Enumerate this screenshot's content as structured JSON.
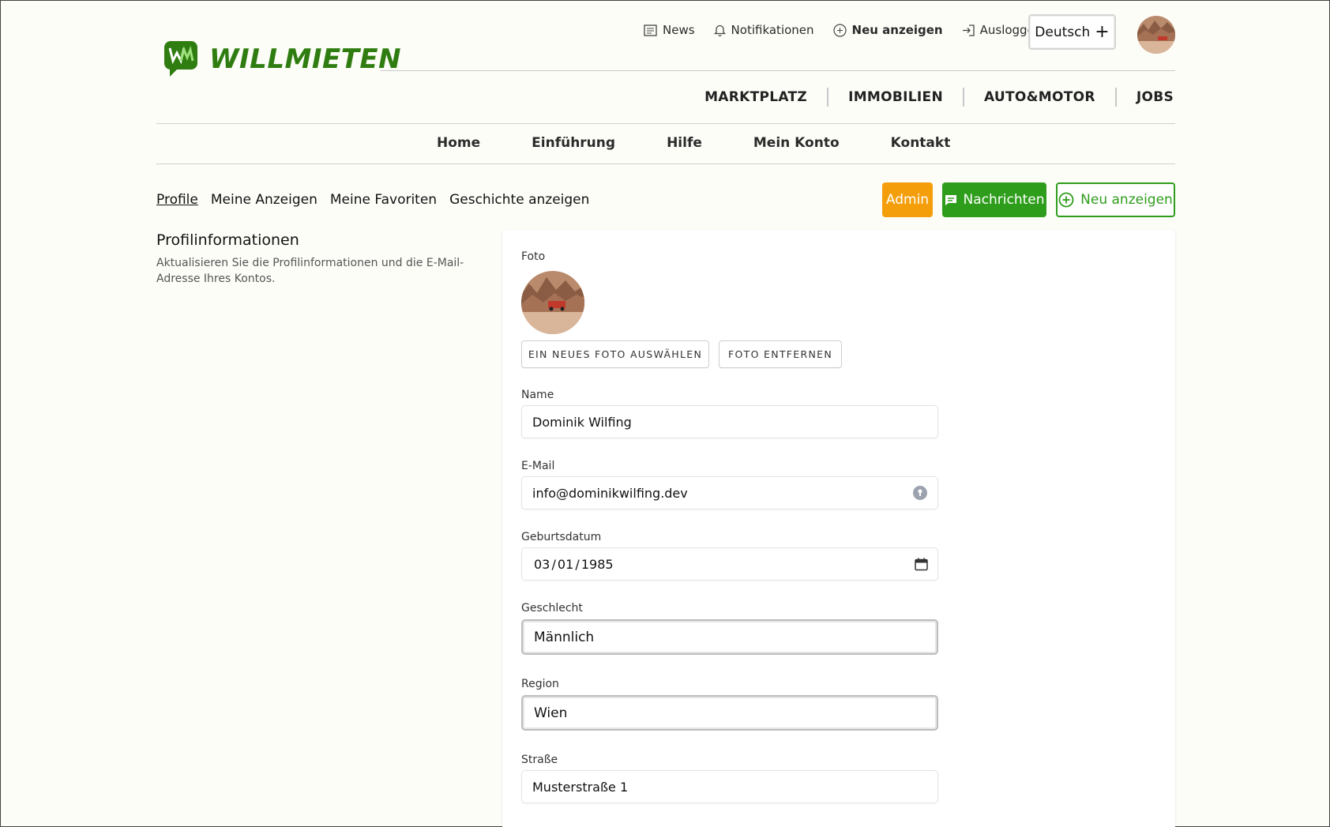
{
  "brand": {
    "name": "WILLMIETEN",
    "mark": "WM"
  },
  "top_util": {
    "news": "News",
    "notifications": "Notifikationen",
    "new_ad": "Neu anzeigen",
    "logout": "Ausloggen",
    "language": "Deutsch"
  },
  "category_nav": [
    "MARKTPLATZ",
    "IMMOBILIEN",
    "AUTO&MOTOR",
    "JOBS"
  ],
  "main_nav": [
    "Home",
    "Einführung",
    "Hilfe",
    "Mein Konto",
    "Kontakt"
  ],
  "sub_nav": [
    "Profile",
    "Meine Anzeigen",
    "Meine Favoriten",
    "Geschichte anzeigen"
  ],
  "actions": {
    "admin": "Admin",
    "messages": "Nachrichten",
    "new_ad": "Neu anzeigen"
  },
  "section": {
    "title": "Profilinformationen",
    "description": "Aktualisieren Sie die Profilinformationen und die E-Mail-Adresse Ihres Kontos."
  },
  "form": {
    "photo_label": "Foto",
    "choose_photo": "EIN NEUES FOTO AUSWÄHLEN",
    "remove_photo": "FOTO ENTFERNEN",
    "name_label": "Name",
    "name_value": "Dominik Wilfing",
    "email_label": "E-Mail",
    "email_value": "info@dominikwilfing.dev",
    "birthdate_label": "Geburtsdatum",
    "birthdate_value": "03 / 01 / 1985",
    "gender_label": "Geschlecht",
    "gender_value": "Männlich",
    "region_label": "Region",
    "region_value": "Wien",
    "street_label": "Straße",
    "street_value": "Musterstraße 1"
  },
  "colors": {
    "brand_green": "#2f7d10",
    "action_green": "#2f9d1c",
    "admin_orange": "#f59e0b",
    "background": "#fdfdf8"
  }
}
